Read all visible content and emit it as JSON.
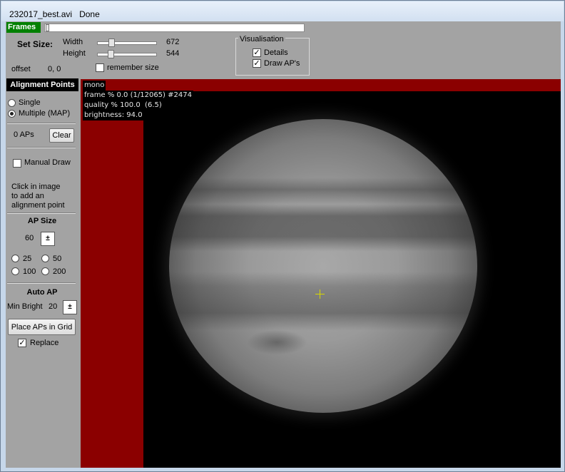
{
  "window": {
    "title": "232017_best.avi   Done"
  },
  "frames": {
    "label": "Frames"
  },
  "set_size": {
    "label": "Set Size:",
    "width_label": "Width",
    "width_value": "672",
    "height_label": "Height",
    "height_value": "544",
    "offset_label": "offset",
    "offset_value": "0, 0",
    "remember_label": "remember size"
  },
  "visualisation": {
    "title": "Visualisation",
    "details_label": "Details",
    "draw_aps_label": "Draw AP's"
  },
  "alignment": {
    "header": "Alignment Points",
    "single_label": "Single",
    "multiple_label": "Multiple (MAP)",
    "ap_count": "0 APs",
    "clear_label": "Clear",
    "manual_draw_label": "Manual Draw",
    "hint_line1": "Click in image",
    "hint_line2": "to add an",
    "hint_line3": "alignment point",
    "ap_size_title": "AP Size",
    "ap_size_value": "60",
    "size_25": "25",
    "size_50": "50",
    "size_100": "100",
    "size_200": "200",
    "auto_ap_title": "Auto AP",
    "min_bright_label": "Min Bright",
    "min_bright_value": "20",
    "place_grid_label": "Place APs in Grid",
    "replace_label": "Replace"
  },
  "overlay": {
    "mode": "mono",
    "frame": "frame % 0.0 (1/12065) #2474",
    "quality": "quality % 100.0  (6.5)",
    "brightness": "brightness: 94.0"
  },
  "colors": {
    "frames_green": "#008000",
    "roi_red": "#8b0000",
    "crosshair": "#d8d800"
  }
}
